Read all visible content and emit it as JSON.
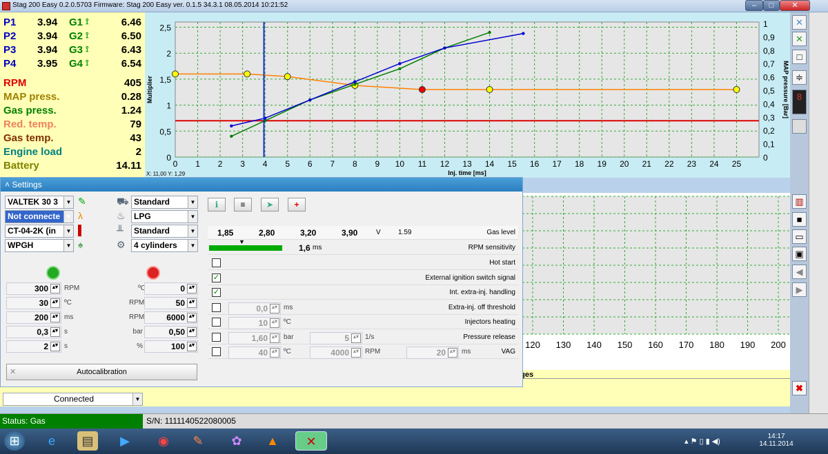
{
  "window": {
    "title": "Stag 200 Easy 0.2.0.5703 Firmware: Stag 200 Easy  ver. 0.1.5  34.3.1  08.05.2014 10:21:52",
    "min": "–",
    "max": "□",
    "close": "✕"
  },
  "params": {
    "p": [
      {
        "l": "P1",
        "v": "3.94"
      },
      {
        "l": "P2",
        "v": "3.94"
      },
      {
        "l": "P3",
        "v": "3.94"
      },
      {
        "l": "P4",
        "v": "3.95"
      }
    ],
    "g": [
      {
        "l": "G1",
        "v": "6.46"
      },
      {
        "l": "G2",
        "v": "6.50"
      },
      {
        "l": "G3",
        "v": "6.43"
      },
      {
        "l": "G4",
        "v": "6.54"
      }
    ],
    "rows": [
      {
        "l": "RPM",
        "v": "405",
        "c": "#e00000"
      },
      {
        "l": "MAP press.",
        "v": "0.28",
        "c": "#a08000"
      },
      {
        "l": "Gas press.",
        "v": "1.24",
        "c": "#008000"
      },
      {
        "l": "Red. temp.",
        "v": "79",
        "c": "#f08060"
      },
      {
        "l": "Gas temp.",
        "v": "43",
        "c": "#803000"
      },
      {
        "l": "Engine load",
        "v": "2",
        "c": "#008080"
      },
      {
        "l": "Battery",
        "v": "14.11",
        "c": "#808000"
      }
    ]
  },
  "chart_data": [
    {
      "type": "line",
      "xlabel": "Inj. time [ms]",
      "ylabel": "Multiplier",
      "y2label": "MAP pressure [Bar]",
      "coords": "X: 11,00  Y: 1,29",
      "xticks": [
        "0",
        "1",
        "2",
        "3",
        "4",
        "5",
        "6",
        "7",
        "8",
        "9",
        "10",
        "11",
        "12",
        "13",
        "14",
        "15",
        "16",
        "17",
        "18",
        "19",
        "20",
        "21",
        "22",
        "23",
        "24",
        "25"
      ],
      "yticks": [
        "0",
        "0,5",
        "1",
        "1,5",
        "2",
        "2,5"
      ],
      "y2ticks": [
        "0",
        "0,1",
        "0,2",
        "0,3",
        "0,4",
        "0,5",
        "0,6",
        "0,7",
        "0,8",
        "0,9",
        "1"
      ],
      "xlim": [
        0,
        26
      ],
      "ylim": [
        0,
        2.6
      ],
      "multiplier_curve": {
        "x": [
          0,
          3.2,
          5,
          8,
          11,
          14,
          20,
          25
        ],
        "y": [
          1.6,
          1.6,
          1.55,
          1.38,
          1.3,
          1.3,
          1.3,
          1.3
        ],
        "color": "#ff8000"
      },
      "red_line": {
        "y": 0.7,
        "color": "#e00000"
      },
      "green_series": {
        "x": [
          2.5,
          4,
          6,
          8,
          10,
          12,
          14
        ],
        "y": [
          0.4,
          0.7,
          1.1,
          1.4,
          1.7,
          2.1,
          2.4
        ],
        "color": "#008000"
      },
      "blue_series": {
        "x": [
          2.5,
          4,
          6,
          8,
          10,
          12,
          15.5
        ],
        "y": [
          0.6,
          0.75,
          1.1,
          1.45,
          1.8,
          2.1,
          2.38
        ],
        "color": "#0000d0"
      },
      "cursor_x": 3.95
    },
    {
      "type": "scatter",
      "xticks": [
        "120",
        "130",
        "140",
        "150",
        "160",
        "170",
        "180",
        "190",
        "200"
      ]
    }
  ],
  "settings": {
    "title": "Settings",
    "left_combos": [
      "VALTEK 30 3",
      "Not connecte",
      "CT-04-2K (in",
      "WPGH"
    ],
    "mid_combos": [
      "Standard",
      "LPG",
      "Standard",
      "4 cylinders"
    ],
    "left_num": [
      {
        "v": "300",
        "u": "RPM"
      },
      {
        "v": "30",
        "u": "ºC"
      },
      {
        "v": "200",
        "u": "ms"
      },
      {
        "v": "0,3",
        "u": "s"
      },
      {
        "v": "2",
        "u": "s"
      }
    ],
    "right_num": [
      {
        "u": "ºC",
        "v": "0"
      },
      {
        "u": "RPM",
        "v": "50"
      },
      {
        "u": "RPM",
        "v": "6000"
      },
      {
        "u": "bar",
        "v": "0,50"
      },
      {
        "u": "%",
        "v": "100"
      }
    ],
    "autocal": "Autocalibration",
    "gas_level": {
      "v": [
        "1,85",
        "2,80",
        "3,20",
        "3,90"
      ],
      "unit": "V",
      "val": "1.59",
      "label": "Gas level"
    },
    "rpm_sens": {
      "val": "1,6",
      "unit": "ms",
      "label": "RPM sensitivity"
    },
    "checks": [
      {
        "label": "Hot start",
        "checked": false
      },
      {
        "label": "External ignition switch signal",
        "checked": true
      },
      {
        "label": "Int. extra-inj. handling",
        "checked": true
      },
      {
        "label": "Extra-inj. off threshold",
        "checked": false,
        "f1": "0,0",
        "u1": "ms"
      },
      {
        "label": "Injectors heating",
        "checked": false,
        "f1": "10",
        "u1": "ºC"
      },
      {
        "label": "Pressure release",
        "checked": false,
        "f1": "1,60",
        "u1": "bar",
        "f2": "5",
        "u2": "1/s"
      },
      {
        "label": "VAG",
        "checked": false,
        "f1": "40",
        "u1": "ºC",
        "f2": "4000",
        "u2": "RPM",
        "f3": "20",
        "u3": "ms"
      }
    ]
  },
  "messages_label": "ages",
  "connection": "Connected",
  "status": {
    "text": "Status: Gas",
    "sn": "S/N: 1111140522080005"
  },
  "clock": {
    "time": "14:17",
    "date": "14.11.2014"
  }
}
